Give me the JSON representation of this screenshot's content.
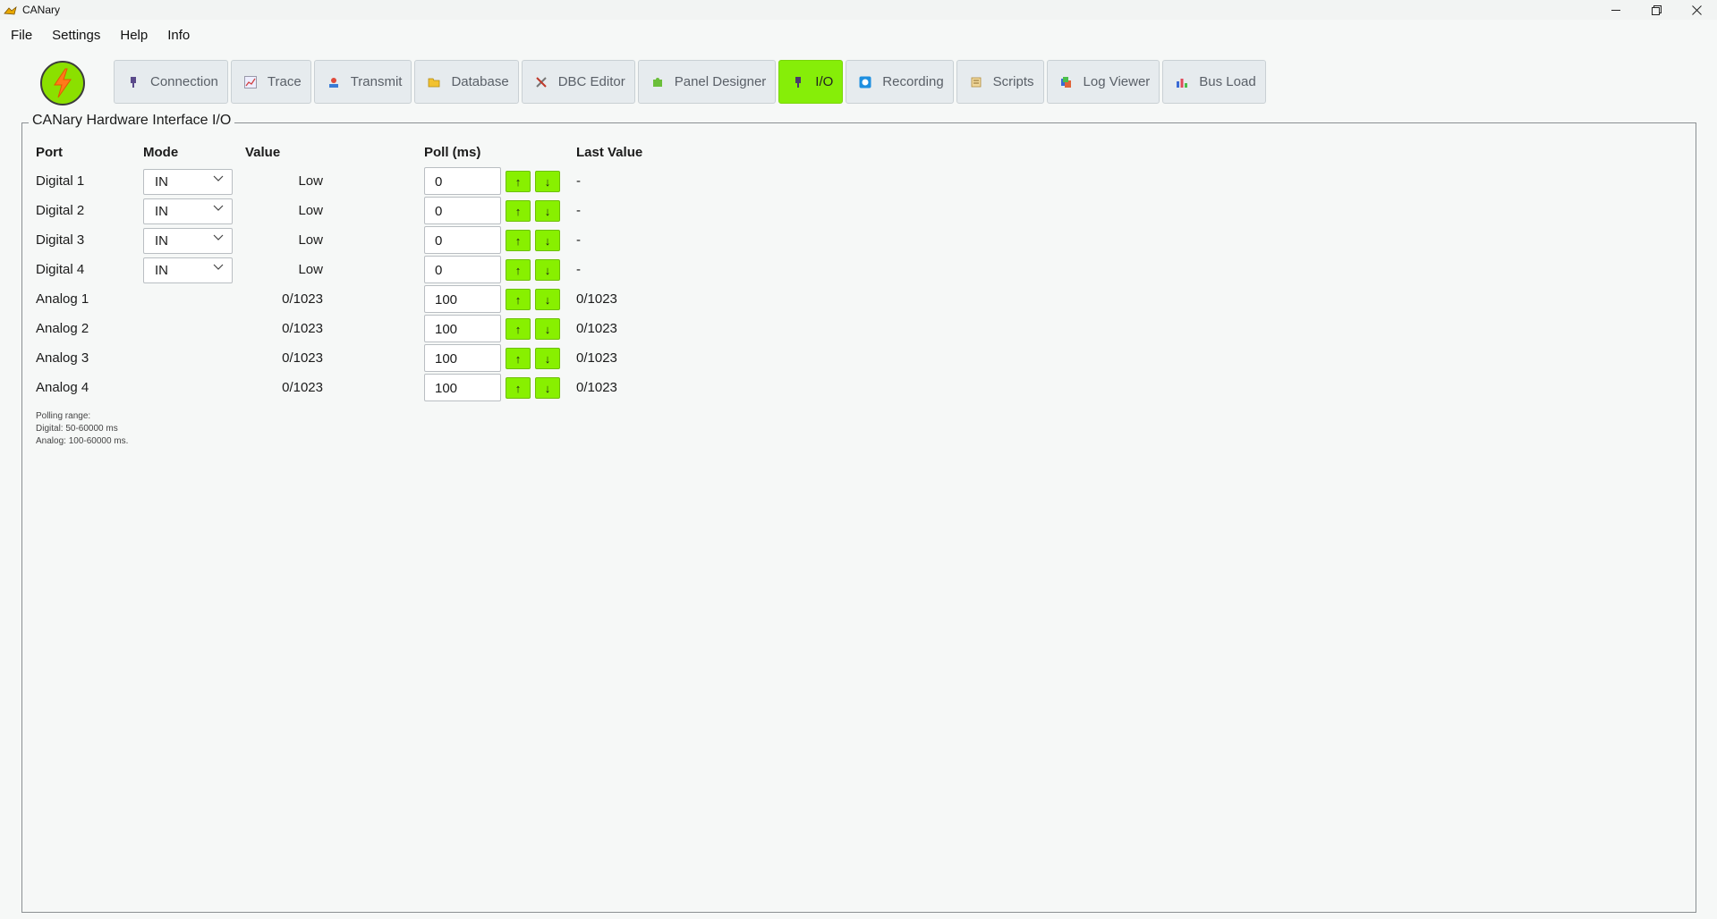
{
  "window": {
    "title": "CANary",
    "minimize": "—",
    "maximize": "❐",
    "close": "✕"
  },
  "menu": [
    "File",
    "Settings",
    "Help",
    "Info"
  ],
  "tabs": [
    {
      "label": "Connection",
      "icon": "plug-icon",
      "active": false
    },
    {
      "label": "Trace",
      "icon": "chart-icon",
      "active": false
    },
    {
      "label": "Transmit",
      "icon": "transmit-icon",
      "active": false
    },
    {
      "label": "Database",
      "icon": "folder-icon",
      "active": false
    },
    {
      "label": "DBC Editor",
      "icon": "tools-icon",
      "active": false
    },
    {
      "label": "Panel Designer",
      "icon": "puzzle-icon",
      "active": false
    },
    {
      "label": "I/O",
      "icon": "plug-icon",
      "active": true
    },
    {
      "label": "Recording",
      "icon": "record-icon",
      "active": false
    },
    {
      "label": "Scripts",
      "icon": "scroll-icon",
      "active": false
    },
    {
      "label": "Log Viewer",
      "icon": "logs-icon",
      "active": false
    },
    {
      "label": "Bus Load",
      "icon": "bar-chart-icon",
      "active": false
    }
  ],
  "group_title": "CANary Hardware Interface I/O",
  "headers": {
    "port": "Port",
    "mode": "Mode",
    "value": "Value",
    "poll": "Poll (ms)",
    "last": "Last Value"
  },
  "rows": [
    {
      "port": "Digital 1",
      "mode": "IN",
      "value": "Low",
      "poll": "0",
      "last": "-"
    },
    {
      "port": "Digital 2",
      "mode": "IN",
      "value": "Low",
      "poll": "0",
      "last": "-"
    },
    {
      "port": "Digital 3",
      "mode": "IN",
      "value": "Low",
      "poll": "0",
      "last": "-"
    },
    {
      "port": "Digital 4",
      "mode": "IN",
      "value": "Low",
      "poll": "0",
      "last": "-"
    },
    {
      "port": "Analog 1",
      "mode": null,
      "value": "0/1023",
      "poll": "100",
      "last": "0/1023"
    },
    {
      "port": "Analog 2",
      "mode": null,
      "value": "0/1023",
      "poll": "100",
      "last": "0/1023"
    },
    {
      "port": "Analog 3",
      "mode": null,
      "value": "0/1023",
      "poll": "100",
      "last": "0/1023"
    },
    {
      "port": "Analog 4",
      "mode": null,
      "value": "0/1023",
      "poll": "100",
      "last": "0/1023"
    }
  ],
  "buttons": {
    "up": "↑",
    "down": "↓"
  },
  "note": [
    "Polling range:",
    "Digital: 50-60000 ms",
    "Analog: 100-60000 ms."
  ],
  "colors": {
    "accent": "#86ee08",
    "tab_bg": "#e6ebee",
    "background": "#f6f8f7"
  }
}
